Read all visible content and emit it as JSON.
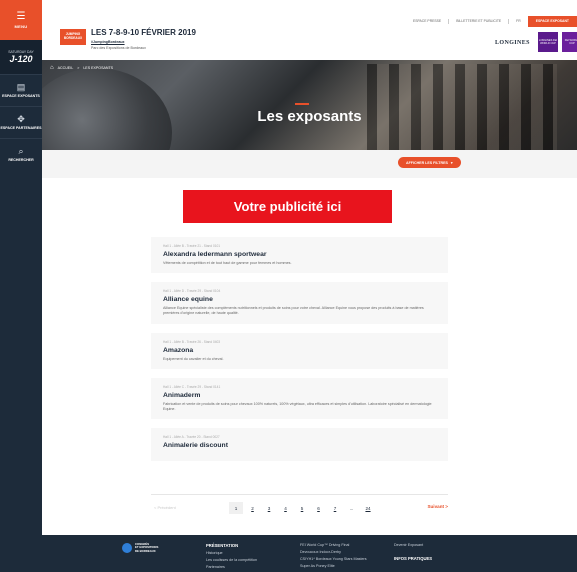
{
  "sidebar": {
    "menu_label": "MENU",
    "countdown_caption": "SATURDAY DAY",
    "countdown_value": "J-120",
    "items": [
      {
        "label": "ESPACE EXPOSANTS",
        "icon": "store-icon"
      },
      {
        "label": "ESPACE PARTENAIRES",
        "icon": "handshake-icon"
      },
      {
        "label": "RECHERCHER",
        "icon": "search-icon"
      }
    ]
  },
  "header": {
    "logo_line1": "JUMPING",
    "logo_line2": "BORDEAUX",
    "title": "LES 7-8-9-10 FÉVRIER 2019",
    "hashtag": "#JumpingBordeaux",
    "venue": "Parc des Expositions de Bordeaux",
    "topnav": [
      "ESPACE PRESSE",
      "BILLETTERIE ET PUBLICITE",
      "FR"
    ],
    "exposant_button": "ESPACE EXPOSANT",
    "sponsor": "LONGINES",
    "badges": [
      "LONGINES FEI WORLD CUP",
      "FEI WORLD CUP"
    ]
  },
  "breadcrumb": {
    "home": "ACCUEIL",
    "separator": ">",
    "current": "LES EXPOSANTS"
  },
  "hero": {
    "title": "Les exposants"
  },
  "filters": {
    "button_label": "AFFICHER LES FILTRES",
    "button_icon": "chevron-down-icon"
  },
  "ad": {
    "text": "Votre publicité ici"
  },
  "exhibitors": [
    {
      "meta": "Hall 1 - Allée B - Travée 21 - Stand 0101",
      "name": "Alexandra ledermann sportwear",
      "desc": "Vêtements de compétition et de tout haut de gamme pour femmes et hommes."
    },
    {
      "meta": "Hall 1 - Allée D - Travée 29 - Stand 0104",
      "name": "Alliance equine",
      "desc": "Alliance Equine spécialiste des compléments nutritionnels et produits de soins pour votre cheval. Alliance Equine vous propose des produits à base de matières premières d'origine naturelle, de haute qualité."
    },
    {
      "meta": "Hall 1 - Allée B - Travée 26 - Stand 0403",
      "name": "Amazona",
      "desc": "Equipement du cavalier et du cheval."
    },
    {
      "meta": "Hall 1 - Allée C - Travée 29 - Stand 0141",
      "name": "Animaderm",
      "desc": "Fabrication et vente de produits de soins pour chevaux 100% naturels, 100% végétaux, ultra efficaces et simples d'utilisation. Laboratoire spécialisé en dermatologie Equine."
    },
    {
      "meta": "Hall 1 - Allée A - Travée 20 - Stand 0027",
      "name": "Animalerie discount",
      "desc": ""
    }
  ],
  "pagination": {
    "prev": "< Précédent",
    "pages": [
      "1",
      "2",
      "3",
      "4",
      "5",
      "6",
      "7",
      "...",
      "24"
    ],
    "current": "1",
    "next": "Suivant >"
  },
  "footer": {
    "logo_line1": "CONGRÈS",
    "logo_line2": "ET EXPOSITIONS",
    "logo_line3": "DE BORDEAUX",
    "col1_head": "PRÉSENTATION",
    "col1_items": [
      "Historique",
      "Les coulisses de la compétition",
      "Partenaires"
    ],
    "col2_items": [
      "FEI World Cup™ Driving Final",
      "Devoucoux Indoor-Derby",
      "CSIYH1* Bordeaux Young Stars Masters",
      "Super As Poney Elite"
    ],
    "col3_items": [
      "Devenir Exposant"
    ],
    "col3_head": "INFOS PRATIQUES"
  }
}
